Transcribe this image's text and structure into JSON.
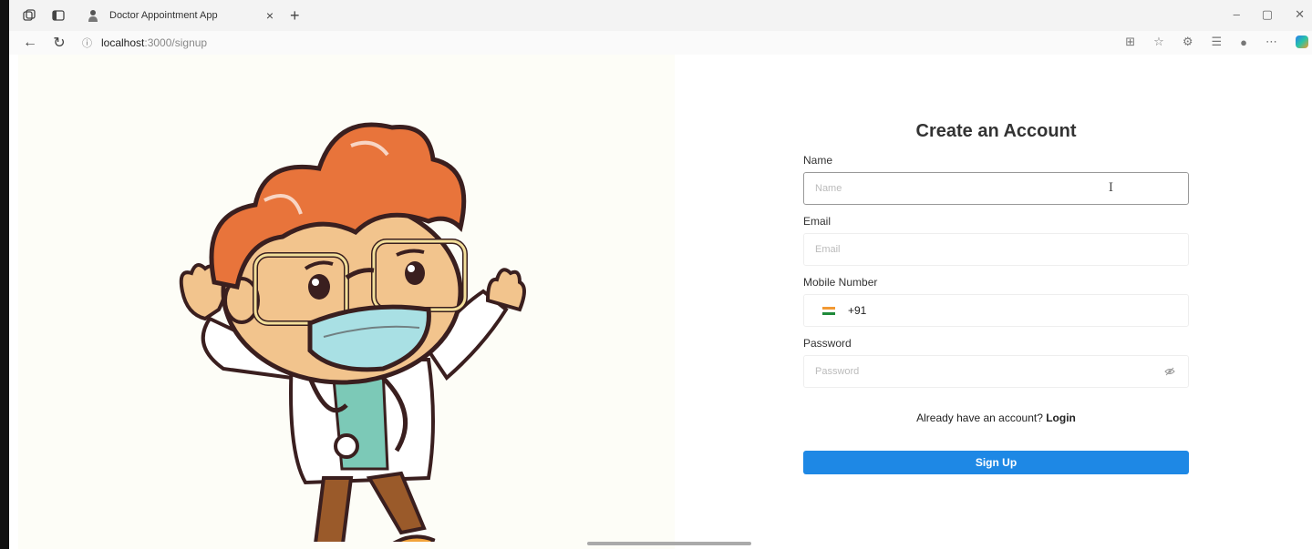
{
  "browser": {
    "tab_title": "Doctor Appointment App",
    "tab_close": "×",
    "new_tab": "+",
    "url_host": "localhost",
    "url_path": ":3000/signup",
    "win_min": "–",
    "win_max": "▢",
    "win_close": "✕",
    "icons": [
      "workspaces-icon",
      "tab-actions-icon",
      "split-screen-icon",
      "favorite-icon",
      "extensions-icon",
      "favorites-list-icon",
      "profile-icon",
      "more-icon",
      "copilot-icon"
    ]
  },
  "form": {
    "title": "Create an Account",
    "name_label": "Name",
    "name_placeholder": "Name",
    "email_label": "Email",
    "email_placeholder": "Email",
    "mobile_label": "Mobile Number",
    "country_code": "+91",
    "password_label": "Password",
    "password_placeholder": "Password",
    "login_prompt": "Already have an account? ",
    "login_link": "Login",
    "signup_button": "Sign Up"
  },
  "colors": {
    "primary": "#1e88e5",
    "illustration_bg": "#fdfdf7",
    "hair": "#e8743b"
  }
}
